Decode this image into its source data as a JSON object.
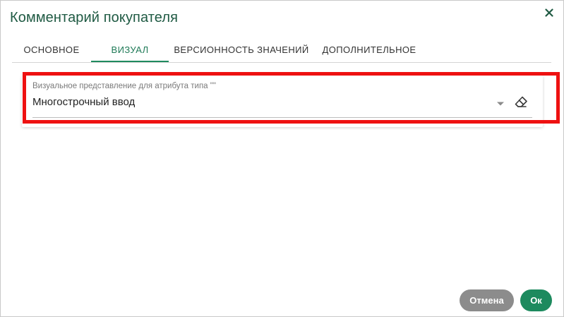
{
  "dialog": {
    "title": "Комментарий покупателя"
  },
  "tabs": [
    {
      "label": "ОСНОВНОЕ",
      "active": false
    },
    {
      "label": "ВИЗУАЛ",
      "active": true
    },
    {
      "label": "ВЕРСИОННОСТЬ ЗНАЧЕНИЙ",
      "active": false
    },
    {
      "label": "ДОПОЛНИТЕЛЬНОЕ",
      "active": false
    }
  ],
  "visual_field": {
    "label": "Визуальное представление для атрибута типа \"\"",
    "value": "Многострочный ввод"
  },
  "footer": {
    "cancel_label": "Отмена",
    "ok_label": "Ок"
  },
  "colors": {
    "accent": "#1d8a5e",
    "title": "#1f5a43",
    "highlight": "#ee1111",
    "cancel_button": "#8c8c8c"
  },
  "icons": {
    "close": "close-icon",
    "dropdown": "chevron-down-icon",
    "clear": "eraser-icon"
  }
}
